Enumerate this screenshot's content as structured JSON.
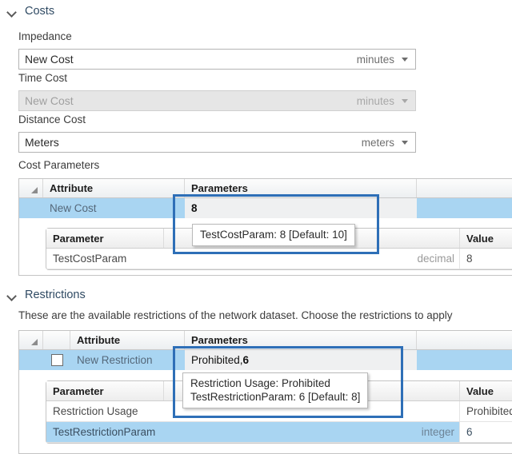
{
  "costs": {
    "section_title": "Costs",
    "chevron_icon": "chevron-down-icon",
    "impedance": {
      "label": "Impedance",
      "value": "New Cost",
      "unit": "minutes"
    },
    "time_cost": {
      "label": "Time Cost",
      "value": "New Cost",
      "unit": "minutes"
    },
    "distance_cost": {
      "label": "Distance Cost",
      "value": "Meters",
      "unit": "meters"
    },
    "cost_parameters": {
      "label": "Cost Parameters",
      "columns": [
        "Attribute",
        "Parameters"
      ],
      "row": {
        "attribute": "New Cost",
        "parameters": "8"
      },
      "inner": {
        "columns": [
          "Parameter",
          "Value"
        ],
        "rows": [
          {
            "parameter": "TestCostParam",
            "type": "decimal",
            "value": "8"
          }
        ]
      },
      "tooltip": "TestCostParam: 8 [Default: 10]"
    }
  },
  "restrictions": {
    "section_title": "Restrictions",
    "chevron_icon": "chevron-down-icon",
    "description": "These are the available restrictions of the network dataset. Choose the restrictions to apply",
    "columns": [
      "Attribute",
      "Parameters"
    ],
    "row": {
      "checked": false,
      "attribute": "New Restriction",
      "parameters_prefix": "Prohibited, ",
      "parameters_bold": "6"
    },
    "inner": {
      "columns": [
        "Parameter",
        "Value"
      ],
      "rows": [
        {
          "parameter": "Restriction Usage",
          "type": "",
          "value": "Prohibited"
        },
        {
          "parameter": "TestRestrictionParam",
          "type": "integer",
          "value": "6"
        }
      ]
    },
    "tooltip_line1": "Restriction Usage: Prohibited",
    "tooltip_line2": "TestRestrictionParam: 6 [Default: 8]"
  },
  "colors": {
    "selection_blue": "#a9d5f2",
    "emphasis_border": "#2e6fb7",
    "section_title": "#2f4a63"
  }
}
